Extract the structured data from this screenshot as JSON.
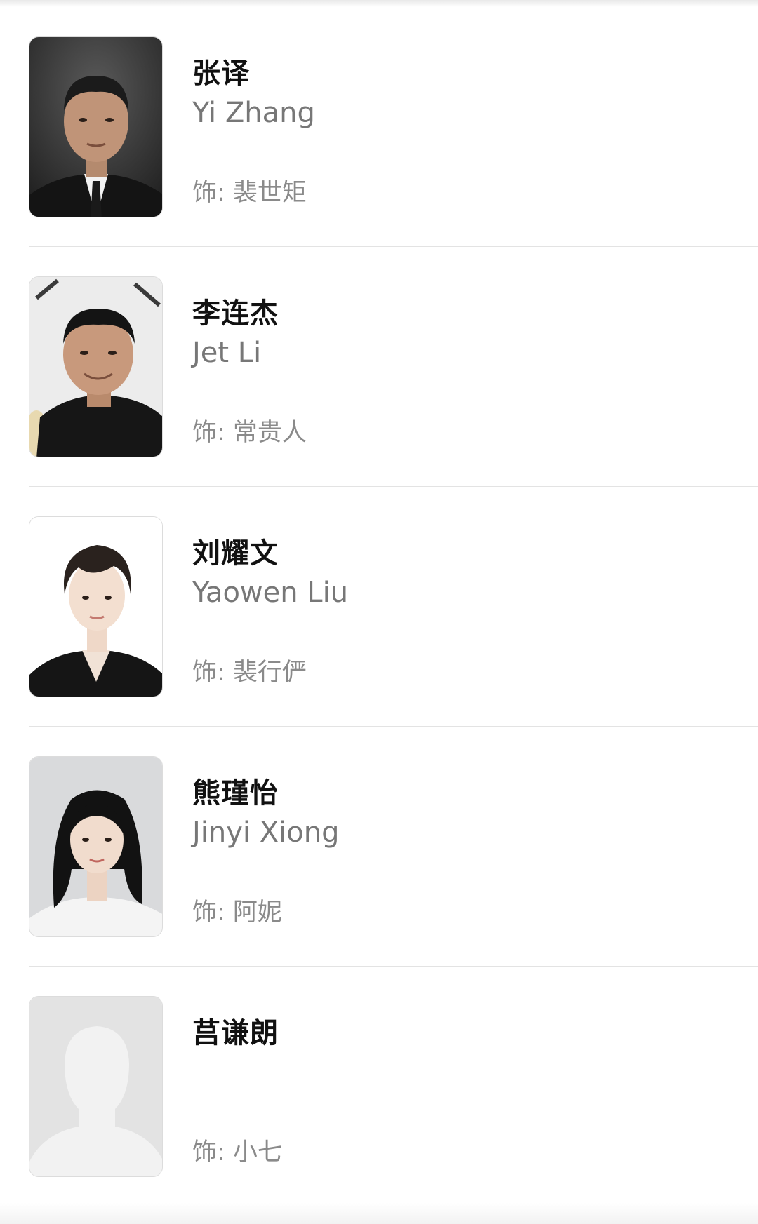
{
  "role_prefix": "饰: ",
  "cast": [
    {
      "name_zh": "张译",
      "name_en": "Yi Zhang",
      "role": "裴世矩",
      "photo_icon": "actor-portrait-dark-suit",
      "photo_bg": "#2a2a2a"
    },
    {
      "name_zh": "李连杰",
      "name_en": "Jet Li",
      "role": "常贵人",
      "photo_icon": "actor-portrait-black-shirt",
      "photo_bg": "#e8e8e8"
    },
    {
      "name_zh": "刘耀文",
      "name_en": "Yaowen Liu",
      "role": "裴行俨",
      "photo_icon": "actor-portrait-white-bg",
      "photo_bg": "#ffffff"
    },
    {
      "name_zh": "熊瑾怡",
      "name_en": "Jinyi Xiong",
      "role": "阿妮",
      "photo_icon": "actress-portrait-gray-bg",
      "photo_bg": "#dcdcdc"
    },
    {
      "name_zh": "莒谦朗",
      "name_en": "",
      "role": "小七",
      "photo_icon": "placeholder-avatar-silhouette",
      "photo_bg": "#e6e6e6"
    }
  ]
}
